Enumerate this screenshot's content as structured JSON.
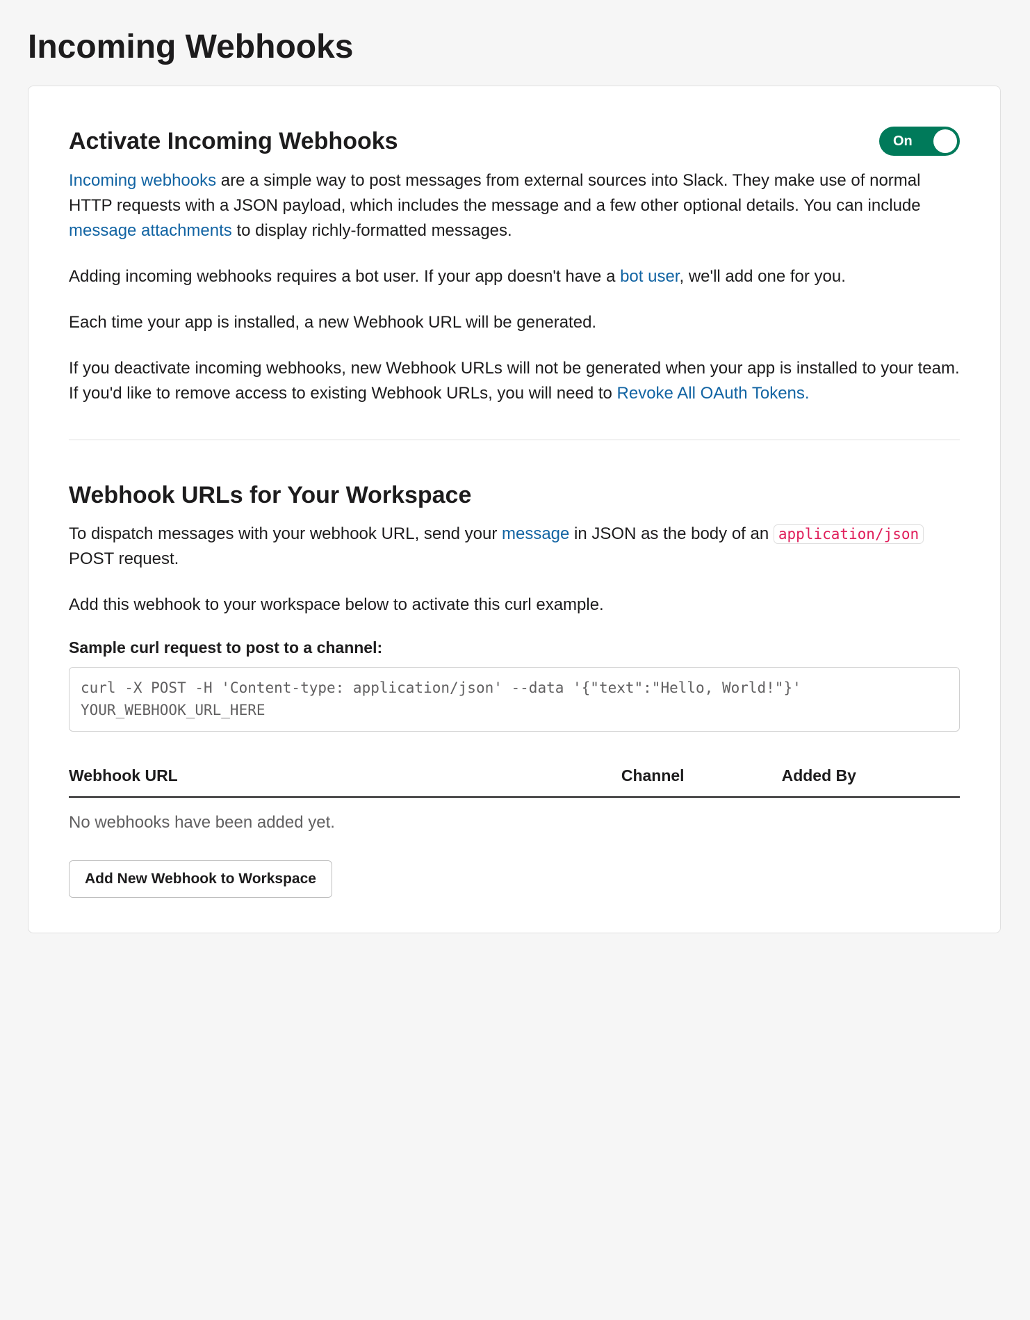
{
  "page": {
    "title": "Incoming Webhooks"
  },
  "activate": {
    "heading": "Activate Incoming Webhooks",
    "toggle": {
      "state_label": "On",
      "value": true
    },
    "para1": {
      "link1": "Incoming webhooks",
      "text1": " are a simple way to post messages from external sources into Slack. They make use of normal HTTP requests with a JSON payload, which includes the message and a few other optional details. You can include ",
      "link2": "message attachments",
      "text2": " to display richly-formatted messages."
    },
    "para2": {
      "text1": "Adding incoming webhooks requires a bot user. If your app doesn't have a ",
      "link1": "bot user",
      "text2": ", we'll add one for you."
    },
    "para3": "Each time your app is installed, a new Webhook URL will be generated.",
    "para4": {
      "text1": "If you deactivate incoming webhooks, new Webhook URLs will not be generated when your app is installed to your team. If you'd like to remove access to existing Webhook URLs, you will need to ",
      "link1": "Revoke All OAuth Tokens."
    }
  },
  "urls": {
    "heading": "Webhook URLs for Your Workspace",
    "para1": {
      "text1": "To dispatch messages with your webhook URL, send your ",
      "link1": "message",
      "text2": " in JSON as the body of an ",
      "code1": "application/json",
      "text3": " POST request."
    },
    "para2": "Add this webhook to your workspace below to activate this curl example.",
    "sample_heading": "Sample curl request to post to a channel:",
    "sample_code": "curl -X POST -H 'Content-type: application/json' --data '{\"text\":\"Hello, World!\"}' YOUR_WEBHOOK_URL_HERE",
    "table": {
      "col_url": "Webhook URL",
      "col_channel": "Channel",
      "col_added_by": "Added By"
    },
    "empty_state": "No webhooks have been added yet.",
    "add_button": "Add New Webhook to Workspace"
  }
}
